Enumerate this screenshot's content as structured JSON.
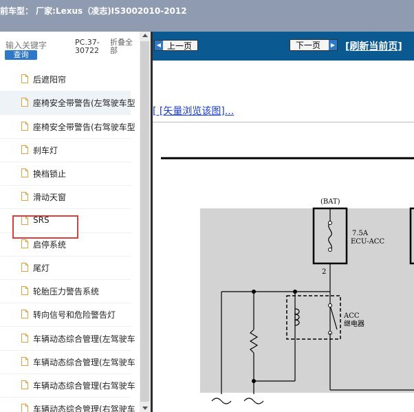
{
  "header": {
    "title": "前车型： 厂家:Lexus（凌志)IS3002010-2012"
  },
  "left_panel": {
    "search": {
      "placeholder": "输入关键字",
      "button_label": "查询"
    },
    "pc_label": "PC.37-30722",
    "fold_label": "折叠全部",
    "tree_items": [
      {
        "label": "后遮阳帘"
      },
      {
        "label": "座椅安全带警告(左驾驶车型"
      },
      {
        "label": "座椅安全带警告(右驾驶车型"
      },
      {
        "label": "刹车灯"
      },
      {
        "label": "换档锁止"
      },
      {
        "label": "滑动天窗"
      },
      {
        "label": "SRS"
      },
      {
        "label": "启停系统"
      },
      {
        "label": "尾灯"
      },
      {
        "label": "轮胎压力警告系统"
      },
      {
        "label": "转向信号和危险警告灯"
      },
      {
        "label": "车辆动态综合管理(左驾驶车"
      },
      {
        "label": "车辆动态综合管理(左驾驶车"
      },
      {
        "label": "车辆动态综合管理(右驾驶车"
      },
      {
        "label": "车辆动态综合管理(右驾驶车"
      }
    ]
  },
  "right_panel": {
    "prev_label": "上一页",
    "next_label": "下一页",
    "refresh_label": "[刷新当前页]",
    "vector_link": "[ [矢量浏览该图]..."
  },
  "diagram": {
    "bat_label": "(BAT)",
    "fuse_rating": "7.5A",
    "fuse_name": "ECU-ACC",
    "pin_label": "2",
    "relay_label_1": "ACC",
    "relay_label_2": "继电器"
  },
  "colors": {
    "topbar": "#8e9bb0",
    "navbar": "#0a5990",
    "highlight": "#e03a3a",
    "diagram_bg": "#d3d3d3"
  }
}
